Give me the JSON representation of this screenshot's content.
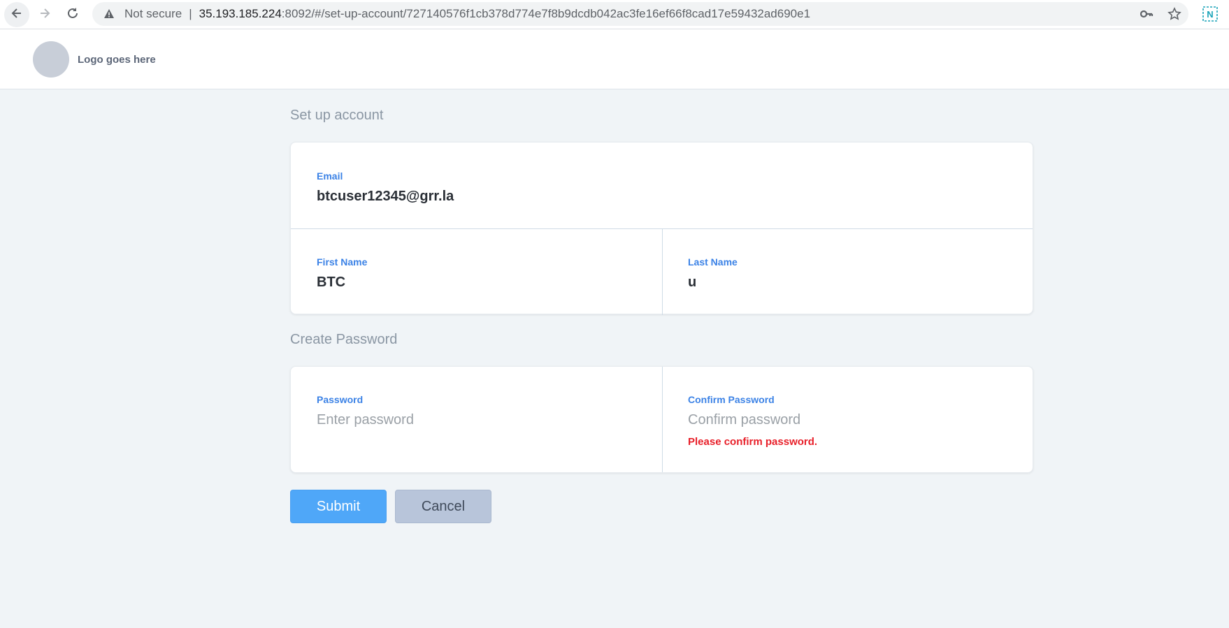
{
  "browser": {
    "security_label": "Not secure",
    "separator": "|",
    "url_host": "35.193.185.224",
    "url_path": ":8092/#/set-up-account/727140576f1cb378d774e7f8b9dcdb042ac3fe16ef66f8cad17e59432ad690e1",
    "extension_label": "N"
  },
  "header": {
    "logo_text": "Logo goes here"
  },
  "account_section": {
    "title": "Set up account",
    "email": {
      "label": "Email",
      "value": "btcuser12345@grr.la"
    },
    "first_name": {
      "label": "First Name",
      "value": "BTC"
    },
    "last_name": {
      "label": "Last Name",
      "value": "u"
    }
  },
  "password_section": {
    "title": "Create Password",
    "password": {
      "label": "Password",
      "placeholder": "Enter password"
    },
    "confirm_password": {
      "label": "Confirm Password",
      "placeholder": "Confirm password",
      "error": "Please confirm password."
    }
  },
  "actions": {
    "submit_label": "Submit",
    "cancel_label": "Cancel"
  },
  "colors": {
    "accent": "#3b82e6",
    "submit_bg": "#4fa7f8",
    "cancel_bg": "#b8c5da",
    "error": "#e8202a",
    "page_bg": "#f0f4f7"
  }
}
